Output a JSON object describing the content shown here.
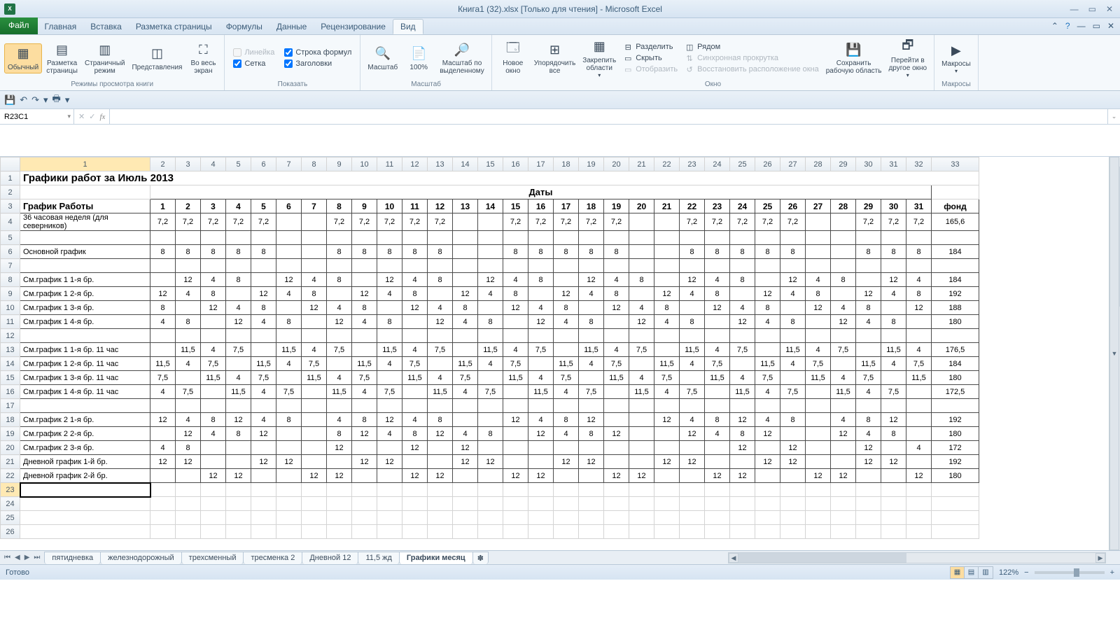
{
  "titlebar": {
    "app_title": "Книга1 (32).xlsx  [Только для чтения]  -  Microsoft Excel",
    "excel_badge": "X"
  },
  "ribbon_tabs": {
    "file": "Файл",
    "tabs": [
      "Главная",
      "Вставка",
      "Разметка страницы",
      "Формулы",
      "Данные",
      "Рецензирование",
      "Вид"
    ],
    "active_index": 6
  },
  "ribbon": {
    "views": {
      "normal": "Обычный",
      "page_layout": "Разметка\nстраницы",
      "page_break": "Страничный\nрежим",
      "custom": "Представления",
      "fullscreen": "Во весь\nэкран",
      "group": "Режимы просмотра книги"
    },
    "show": {
      "ruler": "Линейка",
      "formula_bar": "Строка формул",
      "grid": "Сетка",
      "headings": "Заголовки",
      "group": "Показать"
    },
    "zoom": {
      "zoom": "Масштаб",
      "z100": "100%",
      "to_sel": "Масштаб по\nвыделенному",
      "group": "Масштаб"
    },
    "window": {
      "new": "Новое\nокно",
      "arrange": "Упорядочить\nвсе",
      "freeze": "Закрепить\nобласти",
      "split": "Разделить",
      "hide": "Скрыть",
      "unhide": "Отобразить",
      "side": "Рядом",
      "sync": "Синхронная прокрутка",
      "reset": "Восстановить расположение окна",
      "save_ws": "Сохранить\nрабочую область",
      "switch": "Перейти в\nдругое окно",
      "group": "Окно"
    },
    "macros": {
      "macros": "Макросы",
      "group": "Макросы"
    }
  },
  "namebox": "R23C1",
  "formula": "",
  "columns": [
    "1",
    "2",
    "3",
    "4",
    "5",
    "6",
    "7",
    "8",
    "9",
    "10",
    "11",
    "12",
    "13",
    "14",
    "15",
    "16",
    "17",
    "18",
    "19",
    "20",
    "21",
    "22",
    "23",
    "24",
    "25",
    "26",
    "27",
    "28",
    "29",
    "30",
    "31",
    "32",
    "33"
  ],
  "page_title": "Графики работ за Июль 2013",
  "dates_header": "Даты",
  "header_row": {
    "label": "График Работы",
    "fund": "фонд"
  },
  "days": [
    "1",
    "2",
    "3",
    "4",
    "5",
    "6",
    "7",
    "8",
    "9",
    "10",
    "11",
    "12",
    "13",
    "14",
    "15",
    "16",
    "17",
    "18",
    "19",
    "20",
    "21",
    "22",
    "23",
    "24",
    "25",
    "26",
    "27",
    "28",
    "29",
    "30",
    "31"
  ],
  "rows": [
    {
      "r": 4,
      "label": "36 часовая неделя (для северников)",
      "vals": [
        "7,2",
        "7,2",
        "7,2",
        "7,2",
        "7,2",
        "",
        "",
        "7,2",
        "7,2",
        "7,2",
        "7,2",
        "7,2",
        "",
        "",
        "7,2",
        "7,2",
        "7,2",
        "7,2",
        "7,2",
        "",
        "",
        "7,2",
        "7,2",
        "7,2",
        "7,2",
        "7,2",
        "",
        "",
        "7,2",
        "7,2",
        "7,2"
      ],
      "fund": "165,6"
    },
    {
      "r": 5,
      "label": "",
      "vals": [
        "",
        "",
        "",
        "",
        "",
        "",
        "",
        "",
        "",
        "",
        "",
        "",
        "",
        "",
        "",
        "",
        "",
        "",
        "",
        "",
        "",
        "",
        "",
        "",
        "",
        "",
        "",
        "",
        "",
        "",
        ""
      ],
      "fund": ""
    },
    {
      "r": 6,
      "label": "Основной график",
      "vals": [
        "8",
        "8",
        "8",
        "8",
        "8",
        "",
        "",
        "8",
        "8",
        "8",
        "8",
        "8",
        "",
        "",
        "8",
        "8",
        "8",
        "8",
        "8",
        "",
        "",
        "8",
        "8",
        "8",
        "8",
        "8",
        "",
        "",
        "8",
        "8",
        "8"
      ],
      "fund": "184"
    },
    {
      "r": 7,
      "label": "",
      "vals": [
        "",
        "",
        "",
        "",
        "",
        "",
        "",
        "",
        "",
        "",
        "",
        "",
        "",
        "",
        "",
        "",
        "",
        "",
        "",
        "",
        "",
        "",
        "",
        "",
        "",
        "",
        "",
        "",
        "",
        "",
        ""
      ],
      "fund": ""
    },
    {
      "r": 8,
      "label": "См.график 1  1-я бр.",
      "vals": [
        "",
        "12",
        "4",
        "8",
        "",
        "12",
        "4",
        "8",
        "",
        "12",
        "4",
        "8",
        "",
        "12",
        "4",
        "8",
        "",
        "12",
        "4",
        "8",
        "",
        "12",
        "4",
        "8",
        "",
        "12",
        "4",
        "8",
        "",
        "12",
        "4"
      ],
      "fund": "184"
    },
    {
      "r": 9,
      "label": "См.график 1  2-я бр.",
      "vals": [
        "12",
        "4",
        "8",
        "",
        "12",
        "4",
        "8",
        "",
        "12",
        "4",
        "8",
        "",
        "12",
        "4",
        "8",
        "",
        "12",
        "4",
        "8",
        "",
        "12",
        "4",
        "8",
        "",
        "12",
        "4",
        "8",
        "",
        "12",
        "4",
        "8"
      ],
      "fund": "192"
    },
    {
      "r": 10,
      "label": "См.график 1  3-я бр.",
      "vals": [
        "8",
        "",
        "12",
        "4",
        "8",
        "",
        "12",
        "4",
        "8",
        "",
        "12",
        "4",
        "8",
        "",
        "12",
        "4",
        "8",
        "",
        "12",
        "4",
        "8",
        "",
        "12",
        "4",
        "8",
        "",
        "12",
        "4",
        "8",
        "",
        "12"
      ],
      "fund": "188"
    },
    {
      "r": 11,
      "label": "См.график 1  4-я бр.",
      "vals": [
        "4",
        "8",
        "",
        "12",
        "4",
        "8",
        "",
        "12",
        "4",
        "8",
        "",
        "12",
        "4",
        "8",
        "",
        "12",
        "4",
        "8",
        "",
        "12",
        "4",
        "8",
        "",
        "12",
        "4",
        "8",
        "",
        "12",
        "4",
        "8",
        ""
      ],
      "fund": "180"
    },
    {
      "r": 12,
      "label": "",
      "vals": [
        "",
        "",
        "",
        "",
        "",
        "",
        "",
        "",
        "",
        "",
        "",
        "",
        "",
        "",
        "",
        "",
        "",
        "",
        "",
        "",
        "",
        "",
        "",
        "",
        "",
        "",
        "",
        "",
        "",
        "",
        ""
      ],
      "fund": ""
    },
    {
      "r": 13,
      "label": "См.график 1  1-я бр. 11 час",
      "vals": [
        "",
        "11,5",
        "4",
        "7,5",
        "",
        "11,5",
        "4",
        "7,5",
        "",
        "11,5",
        "4",
        "7,5",
        "",
        "11,5",
        "4",
        "7,5",
        "",
        "11,5",
        "4",
        "7,5",
        "",
        "11,5",
        "4",
        "7,5",
        "",
        "11,5",
        "4",
        "7,5",
        "",
        "11,5",
        "4"
      ],
      "fund": "176,5"
    },
    {
      "r": 14,
      "label": "См.график 1  2-я бр. 11 час",
      "vals": [
        "11,5",
        "4",
        "7,5",
        "",
        "11,5",
        "4",
        "7,5",
        "",
        "11,5",
        "4",
        "7,5",
        "",
        "11,5",
        "4",
        "7,5",
        "",
        "11,5",
        "4",
        "7,5",
        "",
        "11,5",
        "4",
        "7,5",
        "",
        "11,5",
        "4",
        "7,5",
        "",
        "11,5",
        "4",
        "7,5"
      ],
      "fund": "184"
    },
    {
      "r": 15,
      "label": "См.график 1  3-я бр. 11 час",
      "vals": [
        "7,5",
        "",
        "11,5",
        "4",
        "7,5",
        "",
        "11,5",
        "4",
        "7,5",
        "",
        "11,5",
        "4",
        "7,5",
        "",
        "11,5",
        "4",
        "7,5",
        "",
        "11,5",
        "4",
        "7,5",
        "",
        "11,5",
        "4",
        "7,5",
        "",
        "11,5",
        "4",
        "7,5",
        "",
        "11,5"
      ],
      "fund": "180"
    },
    {
      "r": 16,
      "label": "См.график 1  4-я бр. 11 час",
      "vals": [
        "4",
        "7,5",
        "",
        "11,5",
        "4",
        "7,5",
        "",
        "11,5",
        "4",
        "7,5",
        "",
        "11,5",
        "4",
        "7,5",
        "",
        "11,5",
        "4",
        "7,5",
        "",
        "11,5",
        "4",
        "7,5",
        "",
        "11,5",
        "4",
        "7,5",
        "",
        "11,5",
        "4",
        "7,5",
        ""
      ],
      "fund": "172,5"
    },
    {
      "r": 17,
      "label": "",
      "vals": [
        "",
        "",
        "",
        "",
        "",
        "",
        "",
        "",
        "",
        "",
        "",
        "",
        "",
        "",
        "",
        "",
        "",
        "",
        "",
        "",
        "",
        "",
        "",
        "",
        "",
        "",
        "",
        "",
        "",
        "",
        ""
      ],
      "fund": ""
    },
    {
      "r": 18,
      "label": "См.график 2  1-я бр.",
      "vals": [
        "12",
        "4",
        "8",
        "12",
        "4",
        "8",
        "",
        "4",
        "8",
        "12",
        "4",
        "8",
        "",
        "",
        "12",
        "4",
        "8",
        "12",
        "",
        "",
        "12",
        "4",
        "8",
        "12",
        "4",
        "8",
        "",
        "4",
        "8",
        "12",
        ""
      ],
      "fund": "192"
    },
    {
      "r": 19,
      "label": "См.график 2  2-я бр.",
      "vals": [
        "",
        "12",
        "4",
        "8",
        "12",
        "",
        "",
        "8",
        "12",
        "4",
        "8",
        "12",
        "4",
        "8",
        "",
        "12",
        "4",
        "8",
        "12",
        "",
        "",
        "12",
        "4",
        "8",
        "12",
        "",
        "",
        "12",
        "4",
        "8",
        ""
      ],
      "fund": "180"
    },
    {
      "r": 20,
      "label": "См.график 2  3-я бр.",
      "vals": [
        "4",
        "8",
        "",
        "",
        "",
        "",
        "",
        "12",
        "",
        "",
        "12",
        "",
        "12",
        "",
        "",
        "",
        "",
        "",
        "",
        "",
        "",
        "",
        "",
        "12",
        "",
        "12",
        "",
        "",
        "12",
        "",
        "4"
      ],
      "fund": "172"
    },
    {
      "r": 21,
      "label": "Дневной график 1-й бр.",
      "vals": [
        "12",
        "12",
        "",
        "",
        "12",
        "12",
        "",
        "",
        "12",
        "12",
        "",
        "",
        "12",
        "12",
        "",
        "",
        "12",
        "12",
        "",
        "",
        "12",
        "12",
        "",
        "",
        "12",
        "12",
        "",
        "",
        "12",
        "12",
        ""
      ],
      "fund": "192"
    },
    {
      "r": 22,
      "label": "Дневной график 2-й бр.",
      "vals": [
        "",
        "",
        "12",
        "12",
        "",
        "",
        "12",
        "12",
        "",
        "",
        "12",
        "12",
        "",
        "",
        "12",
        "12",
        "",
        "",
        "12",
        "12",
        "",
        "",
        "12",
        "12",
        "",
        "",
        "12",
        "12",
        "",
        "",
        "12"
      ],
      "fund": "180"
    }
  ],
  "empty_rows": [
    23,
    24,
    25,
    26
  ],
  "sheet_tabs": [
    "пятидневка",
    "железнодорожный",
    "трехсменный",
    "тресменка 2",
    "Дневной 12",
    "11,5 жд",
    "Графики месяц"
  ],
  "active_sheet": 6,
  "status": {
    "ready": "Готово",
    "zoom": "122%"
  }
}
